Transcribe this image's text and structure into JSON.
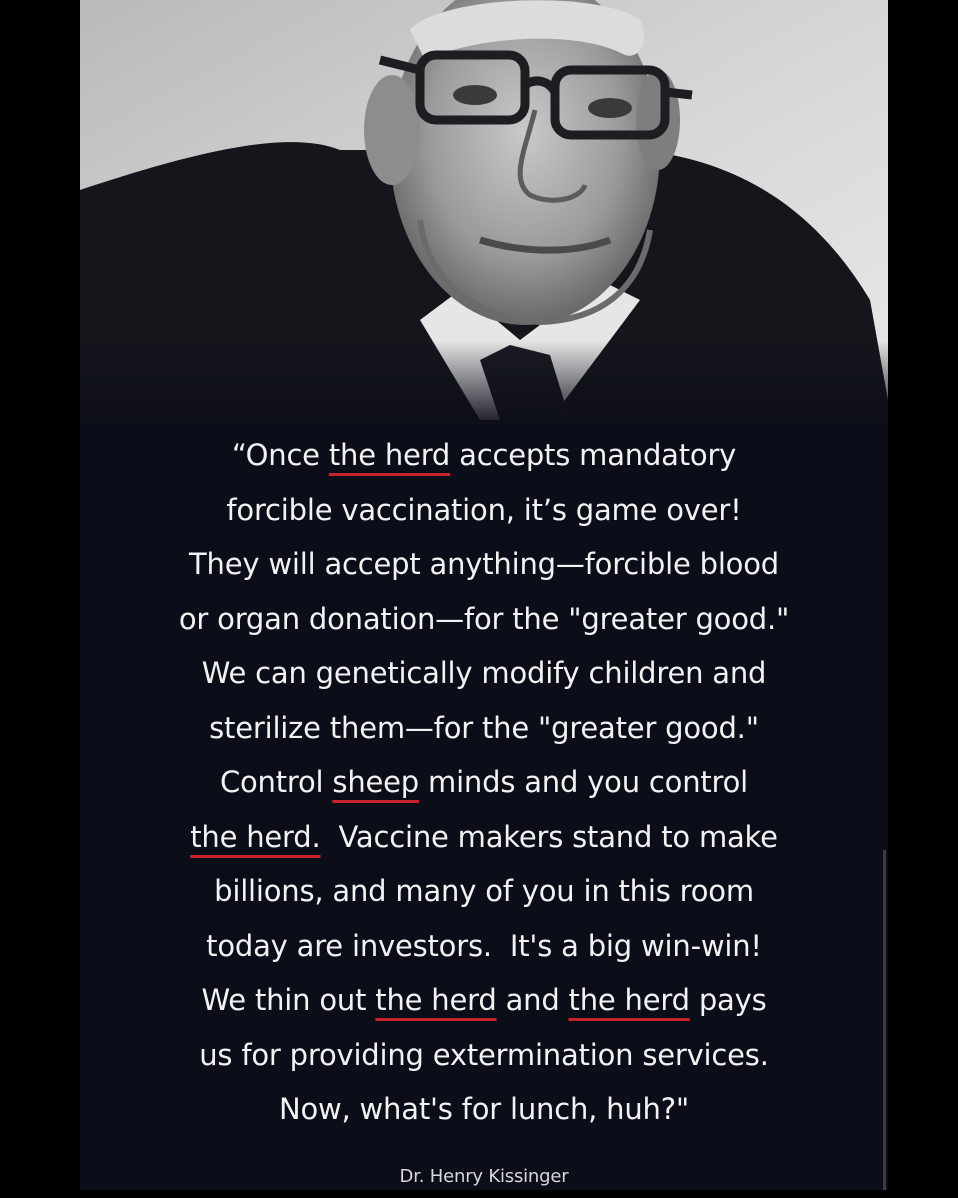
{
  "quote": {
    "lines": [
      [
        {
          "t": "“Once "
        },
        {
          "t": "the herd",
          "u": true
        },
        {
          "t": " accepts mandatory"
        }
      ],
      [
        {
          "t": "forcible vaccination, it’s game over!"
        }
      ],
      [
        {
          "t": "They will accept anything—forcible blood"
        }
      ],
      [
        {
          "t": "or organ donation—for the \"greater good.\""
        }
      ],
      [
        {
          "t": "We can genetically modify children and"
        }
      ],
      [
        {
          "t": "sterilize them—for the \"greater good.\""
        }
      ],
      [
        {
          "t": "Control "
        },
        {
          "t": "sheep",
          "u": true
        },
        {
          "t": " minds and you control"
        }
      ],
      [
        {
          "t": "the herd.",
          "u": true
        },
        {
          "t": "  Vaccine makers stand to make"
        }
      ],
      [
        {
          "t": "billions, and many of you in this room"
        }
      ],
      [
        {
          "t": "today are investors.  It's a big win-win!"
        }
      ],
      [
        {
          "t": "We thin out "
        },
        {
          "t": "the herd",
          "u": true
        },
        {
          "t": " and "
        },
        {
          "t": "the herd",
          "u": true
        },
        {
          "t": " pays"
        }
      ],
      [
        {
          "t": "us for providing extermination services."
        }
      ],
      [
        {
          "t": "Now, what's for lunch, huh?\""
        }
      ]
    ]
  },
  "attribution": "Dr. Henry Kissinger",
  "colors": {
    "background": "#0b0d18",
    "text": "#f2f2f2",
    "underline": "#c8222a"
  }
}
